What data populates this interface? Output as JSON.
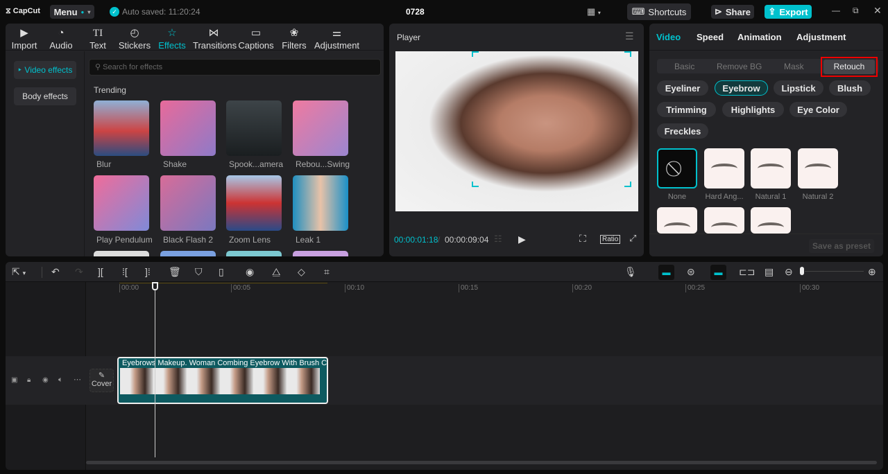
{
  "topbar": {
    "logo": "CapCut",
    "menu": "Menu",
    "autosave": "Auto saved: 11:20:24",
    "project": "0728",
    "shortcuts": "Shortcuts",
    "share": "Share",
    "export": "Export",
    "accent": "#00c1cd"
  },
  "media_tabs": [
    {
      "label": "Import",
      "icon": "import-icon"
    },
    {
      "label": "Audio",
      "icon": "audio-icon"
    },
    {
      "label": "Text",
      "icon": "text-icon"
    },
    {
      "label": "Stickers",
      "icon": "sticker-icon"
    },
    {
      "label": "Effects",
      "icon": "effects-icon"
    },
    {
      "label": "Transitions",
      "icon": "transitions-icon"
    },
    {
      "label": "Captions",
      "icon": "captions-icon"
    },
    {
      "label": "Filters",
      "icon": "filters-icon"
    },
    {
      "label": "Adjustment",
      "icon": "adjustment-icon"
    }
  ],
  "effects": {
    "sidebar": [
      "Video effects",
      "Body effects"
    ],
    "search_placeholder": "Search for effects",
    "section": "Trending",
    "items": [
      {
        "label": "Blur"
      },
      {
        "label": "Shake"
      },
      {
        "label": "Spook...amera"
      },
      {
        "label": "Rebou...Swing"
      },
      {
        "label": "Play Pendulum"
      },
      {
        "label": "Black Flash 2"
      },
      {
        "label": "Zoom Lens"
      },
      {
        "label": "Leak 1"
      }
    ]
  },
  "player": {
    "title": "Player",
    "current": "00:00:01:18",
    "total": "00:00:09:04",
    "ratio": "Ratio"
  },
  "inspector": {
    "tabs": [
      "Video",
      "Speed",
      "Animation",
      "Adjustment"
    ],
    "subtabs": [
      "Basic",
      "Remove BG",
      "Mask",
      "Retouch"
    ],
    "chips": [
      "Eyeliner",
      "Eyebrow",
      "Lipstick",
      "Blush",
      "Trimming",
      "Highlights",
      "Eye Color",
      "Freckles"
    ],
    "presets": [
      "None",
      "Hard Ang...",
      "Natural 1",
      "Natural 2"
    ],
    "save_preset": "Save as preset"
  },
  "timeline": {
    "ticks": [
      "00:00",
      "00:05",
      "00:10",
      "00:15",
      "00:20",
      "00:25",
      "00:30"
    ],
    "cover": "Cover",
    "clip_title": "Eyebrows Makeup. Woman Combing Eyebrow With Brush C"
  }
}
